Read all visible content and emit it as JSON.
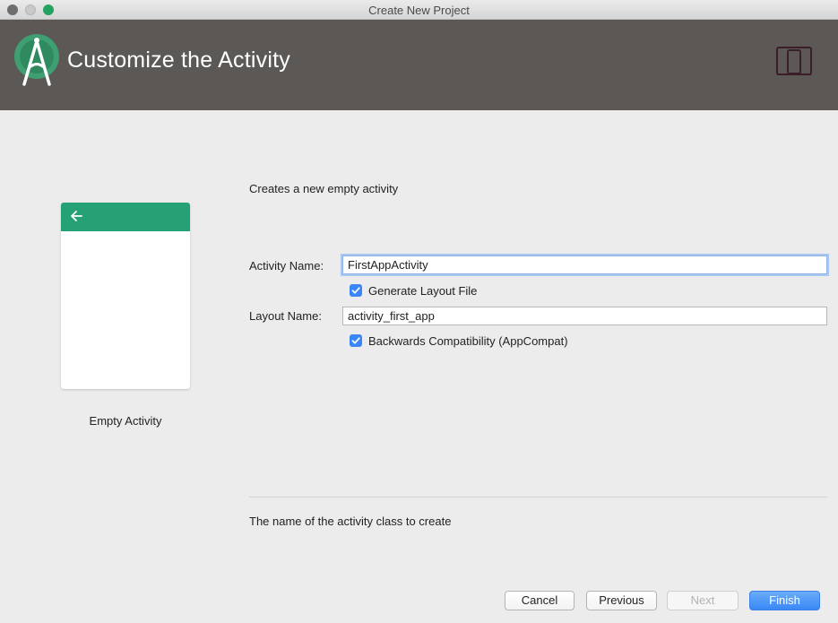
{
  "window": {
    "title": "Create New Project"
  },
  "header": {
    "title": "Customize the Activity",
    "logo_icon": "android-studio-logo",
    "device_icon": "phone-tablet-icon"
  },
  "preview": {
    "template_name": "Empty Activity",
    "appbar_color": "#26a176",
    "back_icon": "arrow-back-icon"
  },
  "form": {
    "description": "Creates a new empty activity",
    "activity_name_label": "Activity Name:",
    "activity_name_value": "FirstAppActivity",
    "generate_layout_label": "Generate Layout File",
    "generate_layout_checked": true,
    "layout_name_label": "Layout Name:",
    "layout_name_value": "activity_first_app",
    "backwards_compat_label": "Backwards Compatibility (AppCompat)",
    "backwards_compat_checked": true
  },
  "hint": "The name of the activity class to create",
  "buttons": {
    "cancel": "Cancel",
    "previous": "Previous",
    "next": "Next",
    "finish": "Finish"
  },
  "colors": {
    "accent": "#3b86f7",
    "header_bg": "#5b5855",
    "android_green": "#3ddc84"
  }
}
